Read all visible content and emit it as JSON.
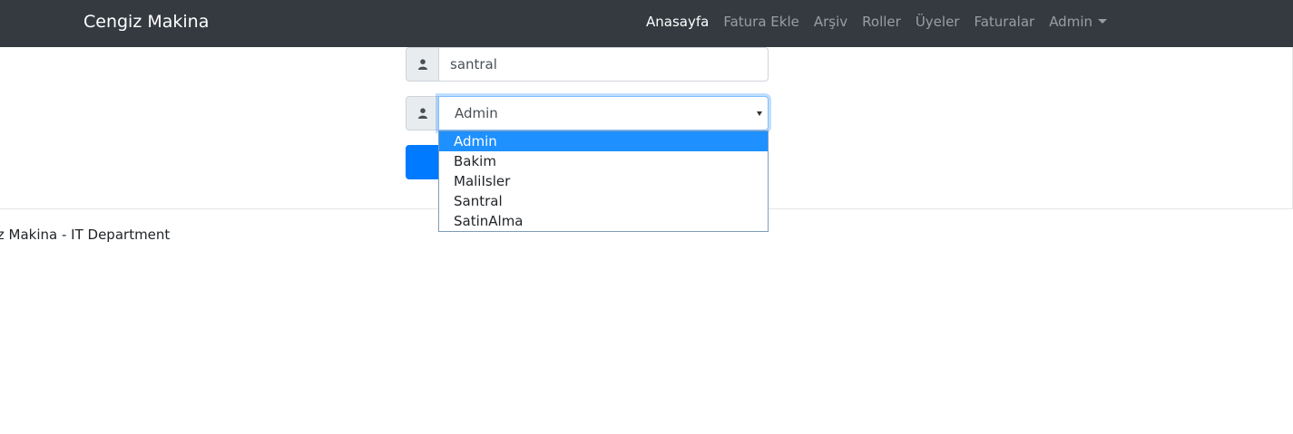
{
  "navbar": {
    "brand": "Cengiz Makina",
    "items": [
      {
        "label": "Anasayfa",
        "active": true
      },
      {
        "label": "Fatura Ekle",
        "active": false
      },
      {
        "label": "Arşiv",
        "active": false
      },
      {
        "label": "Roller",
        "active": false
      },
      {
        "label": "Üyeler",
        "active": false
      },
      {
        "label": "Faturalar",
        "active": false
      },
      {
        "label": "Admin",
        "active": false,
        "dropdown": true
      }
    ]
  },
  "form": {
    "username_value": "santral",
    "username_icon": "user-icon",
    "role_icon": "user-icon",
    "role_selected": "Admin",
    "role_options": [
      "Admin",
      "Bakim",
      "MaliIsler",
      "Santral",
      "SatinAlma"
    ],
    "submit_color": "#007bff"
  },
  "footer": {
    "text": "Cengiz Makina - IT Department"
  },
  "colors": {
    "navbar_bg": "#343a40",
    "accent": "#007bff",
    "option_highlight": "#1e90ff"
  }
}
